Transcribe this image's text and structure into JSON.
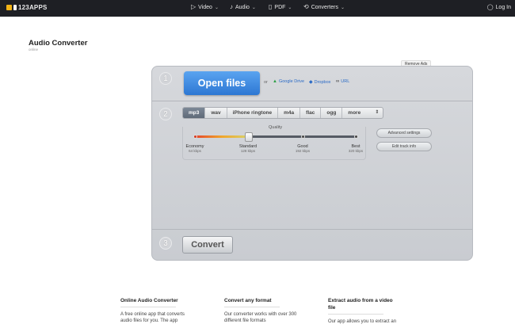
{
  "header": {
    "logo_text": "123APPS",
    "nav": [
      {
        "label": "Video",
        "icon": "video-icon"
      },
      {
        "label": "Audio",
        "icon": "audio-icon"
      },
      {
        "label": "PDF",
        "icon": "pdf-icon"
      },
      {
        "label": "Converters",
        "icon": "converters-icon"
      }
    ],
    "login_label": "Log In"
  },
  "page": {
    "title": "Audio Converter",
    "subtitle": "online",
    "remove_ads": "Remove Ads"
  },
  "converter": {
    "step1": "1",
    "step2": "2",
    "step3": "3",
    "open_files": "Open files",
    "or": "or",
    "sources": [
      "Google Drive",
      "Dropbox",
      "URL"
    ],
    "formats": [
      "mp3",
      "wav",
      "iPhone ringtone",
      "m4a",
      "flac",
      "ogg",
      "more"
    ],
    "active_format": "mp3",
    "quality_label": "Quality",
    "quality_levels": [
      {
        "name": "Economy",
        "bitrate": "64 kbps"
      },
      {
        "name": "Standard",
        "bitrate": "128 kbps"
      },
      {
        "name": "Good",
        "bitrate": "192 kbps"
      },
      {
        "name": "Best",
        "bitrate": "320 kbps"
      }
    ],
    "selected_quality": "Standard",
    "advanced_settings": "Advanced settings",
    "edit_track_info": "Edit track info",
    "convert": "Convert"
  },
  "info": [
    {
      "title": "Online Audio Converter",
      "text": "A free online app that converts audio files for you. The app"
    },
    {
      "title": "Convert any format",
      "text": "Our converter works with over 300 different file formats"
    },
    {
      "title": "Extract audio from a video file",
      "text": "Our app allows you to extract an"
    }
  ],
  "colors": {
    "topbar": "#1e1f24",
    "accent": "#2d77d3"
  }
}
